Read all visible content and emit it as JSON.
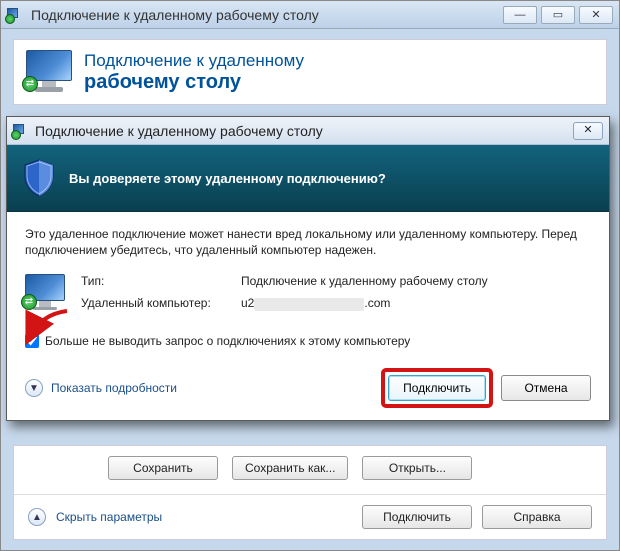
{
  "bg": {
    "title": "Подключение к удаленному рабочему столу",
    "header_line1": "Подключение к удаленному",
    "header_line2": "рабочему столу",
    "btn_save": "Сохранить",
    "btn_save_as": "Сохранить как...",
    "btn_open": "Открыть...",
    "collapse_label": "Скрыть параметры",
    "btn_connect": "Подключить",
    "btn_help": "Справка",
    "min": "—",
    "max": "▭",
    "close": "✕"
  },
  "modal": {
    "title": "Подключение к удаленному рабочему столу",
    "question": "Вы доверяете этому удаленному подключению?",
    "warn": "Это удаленное подключение может нанести вред локальному или удаленному компьютеру. Перед подключением убедитесь, что удаленный компьютер надежен.",
    "type_label": "Тип:",
    "type_value": "Подключение к удаленному рабочему столу",
    "computer_label": "Удаленный компьютер:",
    "computer_prefix": "u2",
    "computer_suffix": ".com",
    "checkbox_label": "Больше не выводить запрос о подключениях к этому компьютеру",
    "checkbox_checked": true,
    "details_label": "Показать подробности",
    "btn_connect": "Подключить",
    "btn_cancel": "Отмена",
    "close": "✕"
  }
}
